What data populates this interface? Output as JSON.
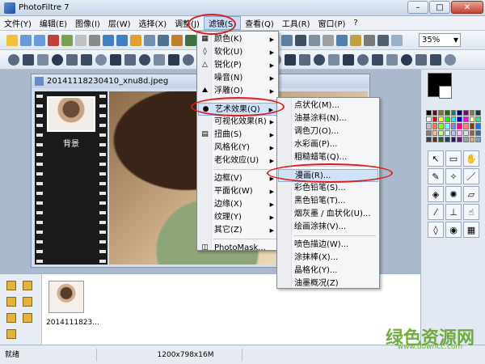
{
  "window": {
    "title": "PhotoFiltre 7",
    "minimize": "–",
    "maximize": "□",
    "close": "✕"
  },
  "menubar": [
    {
      "label": "文件(Y)"
    },
    {
      "label": "编辑(E)"
    },
    {
      "label": "图像(I)"
    },
    {
      "label": "层(W)"
    },
    {
      "label": "选择(X)"
    },
    {
      "label": "调整(J)"
    },
    {
      "label": "滤镜(S)",
      "active": true
    },
    {
      "label": "查看(Q)"
    },
    {
      "label": "工具(R)"
    },
    {
      "label": "窗口(P)"
    },
    {
      "label": "?"
    }
  ],
  "toolbar": {
    "zoom": "35%"
  },
  "image_window": {
    "title": "20141118230410_xnu8d.jpeg",
    "layer_label": "背景"
  },
  "filter_menu": [
    {
      "label": "颜色(K)",
      "icon": "color-icon",
      "submenu": true
    },
    {
      "label": "软化(U)",
      "icon": "droplet-icon",
      "submenu": true
    },
    {
      "label": "锐化(P)",
      "icon": "triangle-icon",
      "submenu": true
    },
    {
      "label": "噪音(N)",
      "icon": "",
      "submenu": true
    },
    {
      "label": "浮雕(O)",
      "icon": "mountain-icon",
      "submenu": true
    },
    {
      "label": "艺术效果(Q)",
      "icon": "art-icon",
      "submenu": true,
      "highlight": true
    },
    {
      "label": "可视化效果(R)",
      "icon": "",
      "submenu": true
    },
    {
      "label": "扭曲(S)",
      "icon": "grid-icon",
      "submenu": true
    },
    {
      "label": "风格化(Y)",
      "icon": "",
      "submenu": true
    },
    {
      "label": "老化效应(U)",
      "icon": "",
      "submenu": true
    },
    {
      "label": "边框(V)",
      "icon": "",
      "submenu": true
    },
    {
      "label": "平面化(W)",
      "icon": "",
      "submenu": true
    },
    {
      "label": "边缘(X)",
      "icon": "",
      "submenu": true
    },
    {
      "label": "纹理(Y)",
      "icon": "",
      "submenu": true
    },
    {
      "label": "其它(Z)",
      "icon": "",
      "submenu": true
    },
    {
      "label": "PhotoMask...",
      "icon": "mask-icon",
      "submenu": false
    }
  ],
  "art_submenu": [
    {
      "label": "点状化(M)..."
    },
    {
      "label": "油基涂料(N)..."
    },
    {
      "label": "调色刀(O)..."
    },
    {
      "label": "水彩画(P)..."
    },
    {
      "label": "粗糙蜡笔(Q)..."
    },
    {
      "label": "漫画(R)...",
      "highlight": true
    },
    {
      "label": "彩色铅笔(S)..."
    },
    {
      "label": "黑色铅笔(T)..."
    },
    {
      "label": "烟灰墨 / 血状化(U)..."
    },
    {
      "label": "绘画涂抹(V)..."
    },
    {
      "label": "喷色描边(W)..."
    },
    {
      "label": "涂抹棒(X)..."
    },
    {
      "label": "晶格化(Y)..."
    },
    {
      "label": "油墨概况(Z)"
    }
  ],
  "bottom_panel": {
    "thumb_label": "2014111823..."
  },
  "status": {
    "state": "就绪",
    "size": "1200x798x16M"
  },
  "watermark": {
    "text": "绿色资源网",
    "sub": "www.downcc.com"
  },
  "colors": {
    "accent": "#d81e1e",
    "highlight": "#cfe2f8"
  }
}
